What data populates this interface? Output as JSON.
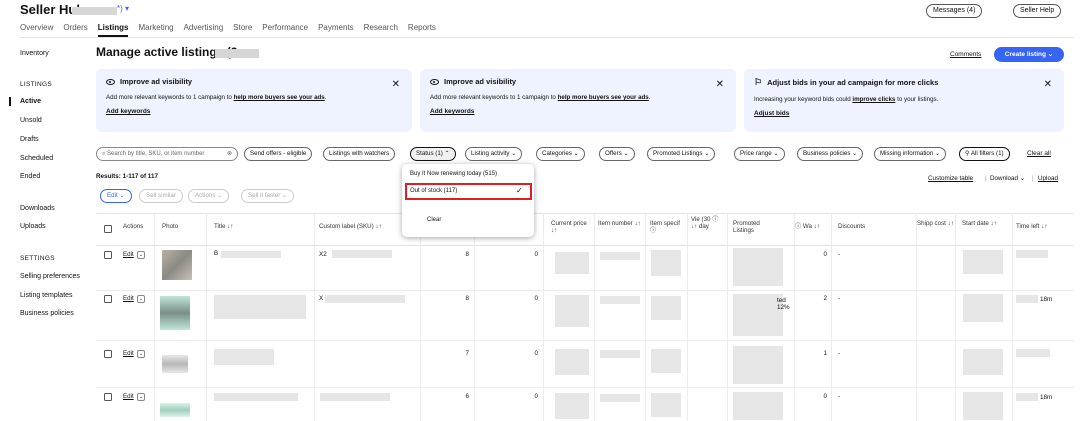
{
  "header": {
    "brand": "Seller Hub",
    "brand_suffix": "*) ▾",
    "messages": "Messages (4)",
    "help": "Seller Help"
  },
  "topnav": [
    "Overview",
    "Orders",
    "Listings",
    "Marketing",
    "Advertising",
    "Store",
    "Performance",
    "Payments",
    "Research",
    "Reports"
  ],
  "topnav_active": "Listings",
  "sidebar": {
    "inventory": "Inventory",
    "listings_heading": "LISTINGS",
    "listings": [
      "Active",
      "Unsold",
      "Drafts",
      "Scheduled",
      "Ended"
    ],
    "active": "Active",
    "downloads": "Downloads",
    "uploads": "Uploads",
    "settings_heading": "SETTINGS",
    "settings": [
      "Selling preferences",
      "Listing templates",
      "Business policies"
    ]
  },
  "main": {
    "title": "Manage active listings (2",
    "comments": "Comments",
    "create_listing": "Create listing ⌄"
  },
  "cards": [
    {
      "title": "Improve ad visibility",
      "desc_pre": "Add more relevant keywords to 1 campaign to ",
      "desc_link": "help more buyers see your ads",
      "desc_post": ".",
      "action": "Add keywords",
      "icon": "eye-icon"
    },
    {
      "title": "Improve ad visibility",
      "desc_pre": "Add more relevant keywords to 1 campaign to ",
      "desc_link": "help more buyers see your ads",
      "desc_post": ".",
      "action": "Add keywords",
      "icon": "eye-icon"
    },
    {
      "title": "Adjust bids in your ad campaign for more clicks",
      "desc_pre": "Increasing your keyword bids could ",
      "desc_link": "improve clicks",
      "desc_post": " to your listings.",
      "action": "Adjust bids",
      "icon": "bid-icon"
    }
  ],
  "filters": {
    "search_placeholder": "Search by title, SKU, or item number",
    "buttons": [
      "Send offers - eligible",
      "Listings with watchers",
      "Status (1) ⌃",
      "Listing activity ⌄",
      "Categories ⌄",
      "Offers ⌄",
      "Promoted Listings ⌄",
      "Price range ⌄",
      "Business policies ⌄",
      "Missing information ⌄"
    ],
    "all_filters": "All filters (1)",
    "clear_all": "Clear all"
  },
  "status_dropdown": {
    "options": [
      "Buy It Now renewing today (515)",
      "Out of stock (117)"
    ],
    "selected": "Out of stock (117)",
    "clear": "Clear"
  },
  "results": {
    "summary": "Results: 1-117 of 117",
    "customize": "Customize table",
    "download": "Download ⌄",
    "upload": "Upload",
    "bulk_buttons": [
      "Edit ⌄",
      "Sell similar",
      "Actions ⌄",
      "Sell it faster ⌄"
    ]
  },
  "table": {
    "headers": {
      "actions": "Actions",
      "photo": "Photo",
      "title": "Title ↓↑",
      "sku": "Custom label (SKU) ↓↑",
      "price": "Current price ↓↑",
      "item_number": "Item number ↓↑",
      "item_specifics": "Item specif ⓘ",
      "views": "Vie (30 ⓘ ↓↑ day",
      "promoted": "Promoted Listings",
      "watchers": "ⓘ Wa ↓↑",
      "discounts": "Discounts",
      "shipping": "Shipp cost ↓↑",
      "start_date": "Start date ↓↑",
      "time_left": "Time left ↓↑"
    },
    "rows": [
      {
        "edit": "Edit",
        "sku": "X2",
        "qty1": "8",
        "qty2": "0",
        "watchers": "0",
        "discounts": "-",
        "time_left": "",
        "promo_extra": ""
      },
      {
        "edit": "Edit",
        "sku": "X",
        "qty1": "8",
        "qty2": "0",
        "watchers": "2",
        "discounts": "-",
        "time_left": "18m",
        "promo_extra": "ted 12%"
      },
      {
        "edit": "Edit",
        "sku": "",
        "qty1": "7",
        "qty2": "0",
        "watchers": "1",
        "discounts": "-",
        "time_left": "",
        "promo_extra": ""
      },
      {
        "edit": "Edit",
        "sku": "",
        "qty1": "6",
        "qty2": "0",
        "watchers": "0",
        "discounts": "-",
        "time_left": "18m",
        "promo_extra": ""
      }
    ]
  },
  "colors": {
    "accent": "#3665f3",
    "card_bg": "#eef3ff",
    "highlight": "#e02020"
  }
}
